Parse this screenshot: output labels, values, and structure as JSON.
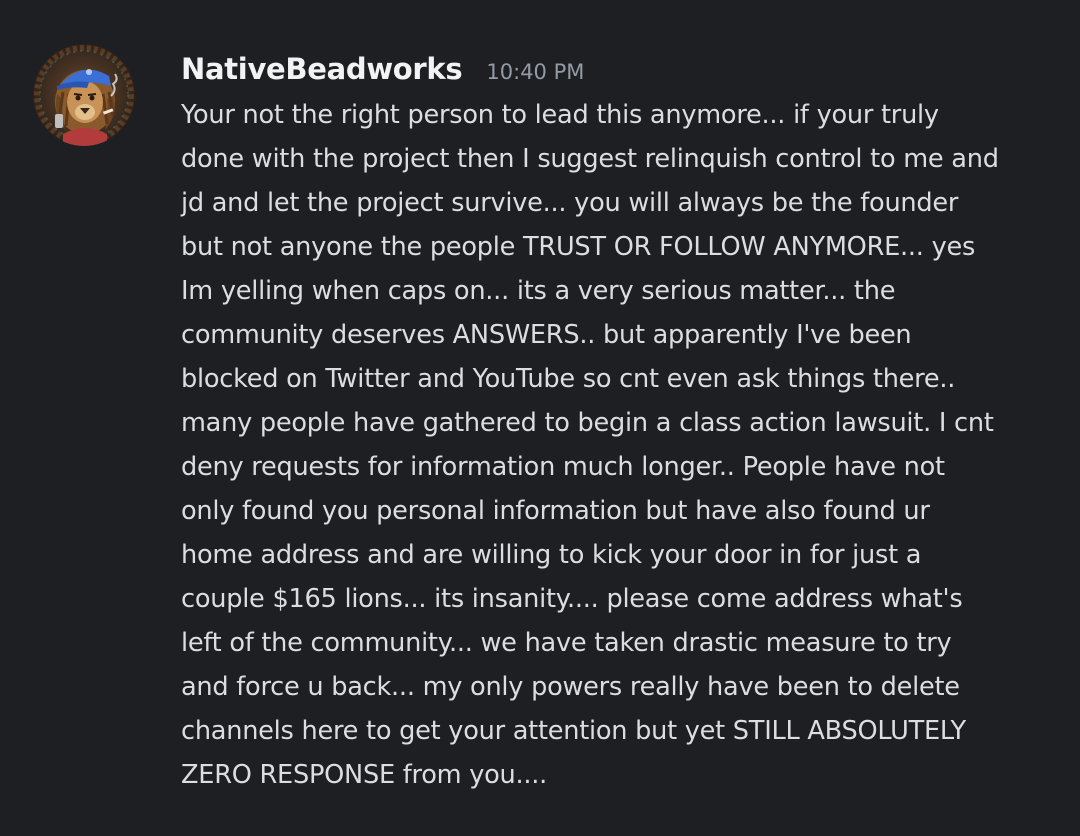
{
  "message": {
    "author": "NativeBeadworks",
    "timestamp": "10:40 PM",
    "avatar": "lion-avatar-with-blue-cap",
    "lines": [
      "Your not the right person to lead this anymore... if your truly",
      "done with the project then I suggest relinquish control to me and",
      "jd and let the project survive... you will always be the founder",
      "but not anyone the people TRUST OR FOLLOW ANYMORE... yes",
      "Im yelling when caps on... its a very serious matter... the",
      "community deserves ANSWERS.. but apparently I've been",
      "blocked on Twitter and YouTube so cnt even ask things there..",
      "many people have gathered to begin a class action lawsuit. I cnt",
      "deny requests for information much longer.. People have not",
      "only found you personal information but have also found ur",
      "home address and are willing to kick your door in for just a",
      "couple $165 lions... its insanity.... please come address what's",
      "left of the community... we have taken drastic measure to try",
      "and force u back... my only powers really have been to delete",
      "channels here to get your attention but yet STILL ABSOLUTELY",
      "ZERO RESPONSE from you...."
    ]
  },
  "colors": {
    "background": "#1e1f22",
    "username": "#f2f3f5",
    "timestamp": "#949ba4",
    "text": "#dbdee1",
    "avatar_cap": "#3b6fd6",
    "avatar_ring": "#4a3526"
  }
}
